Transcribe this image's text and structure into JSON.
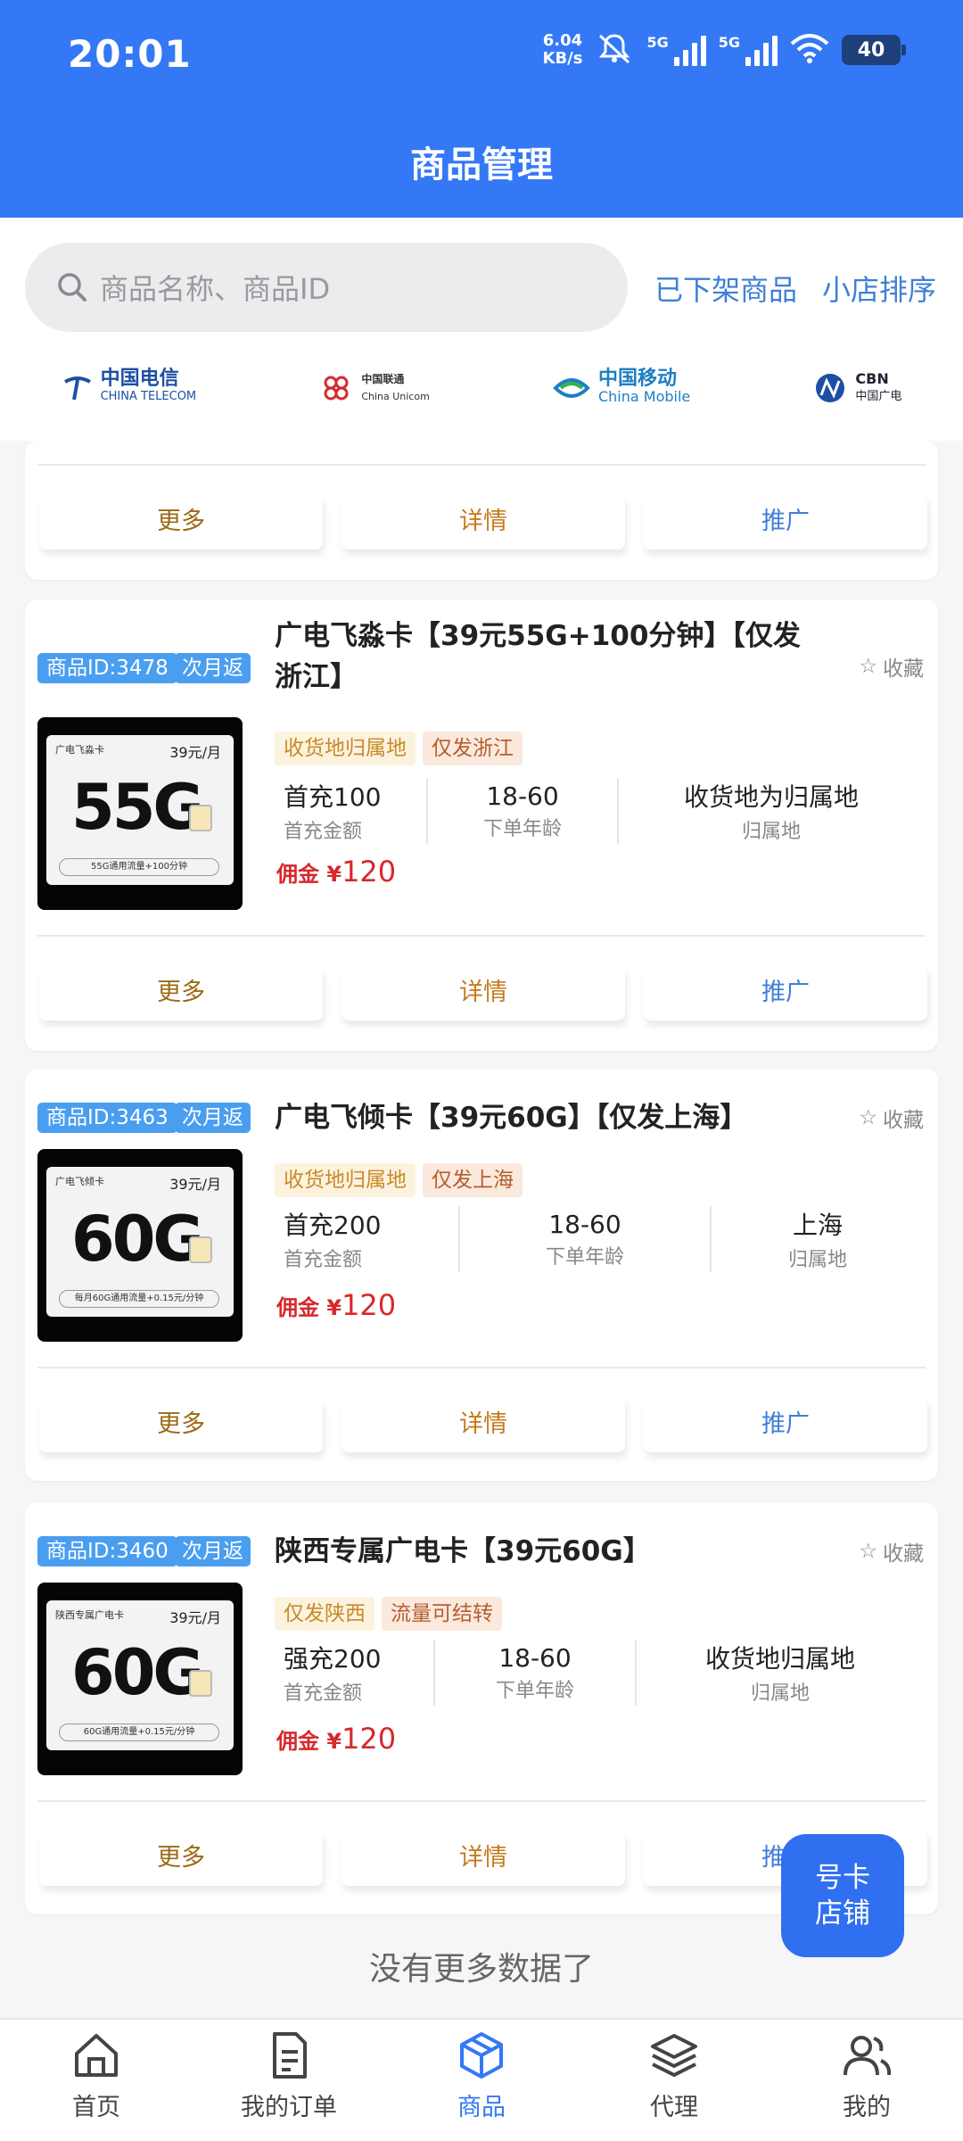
{
  "status": {
    "time": "20:01",
    "netspeed_value": "6.04",
    "netspeed_unit": "KB/s",
    "sig1": "5G",
    "sig2": "5G",
    "battery": "40"
  },
  "header": {
    "title": "商品管理"
  },
  "search": {
    "placeholder": "商品名称、商品ID",
    "removed_link": "已下架商品",
    "sort_link": "小店排序"
  },
  "operators": [
    {
      "name": "中国电信",
      "en": "CHINA TELECOM"
    },
    {
      "name": "中国联通",
      "en": "China Unicom"
    },
    {
      "name": "中国移动",
      "en": "China Mobile"
    },
    {
      "name": "中国广电",
      "en": "CBN"
    }
  ],
  "actions": {
    "more": "更多",
    "detail": "详情",
    "promote": "推广"
  },
  "products": [
    {
      "id_label": "商品ID:3478",
      "return_label": "次月返",
      "title": "广电飞淼卡【39元55G+100分钟】【仅发浙江】",
      "favorite": "收藏",
      "image": {
        "brand": "广电飞淼卡",
        "price": "39元/月",
        "data": "55G",
        "desc": "55G通用流量+100分钟"
      },
      "chips": [
        "收货地归属地",
        "仅发浙江"
      ],
      "stats": [
        {
          "value": "首充100",
          "label": "首充金额"
        },
        {
          "value": "18-60",
          "label": "下单年龄"
        },
        {
          "value": "收货地为归属地",
          "label": "归属地"
        }
      ],
      "commission_label": "佣金 ¥",
      "commission_value": "120"
    },
    {
      "id_label": "商品ID:3463",
      "return_label": "次月返",
      "title": "广电飞倾卡【39元60G】【仅发上海】",
      "favorite": "收藏",
      "image": {
        "brand": "广电飞倾卡",
        "price": "39元/月",
        "data": "60G",
        "desc": "每月60G通用流量+0.15元/分钟"
      },
      "chips": [
        "收货地归属地",
        "仅发上海"
      ],
      "stats": [
        {
          "value": "首充200",
          "label": "首充金额"
        },
        {
          "value": "18-60",
          "label": "下单年龄"
        },
        {
          "value": "上海",
          "label": "归属地"
        }
      ],
      "commission_label": "佣金 ¥",
      "commission_value": "120"
    },
    {
      "id_label": "商品ID:3460",
      "return_label": "次月返",
      "title": "陕西专属广电卡【39元60G】",
      "favorite": "收藏",
      "image": {
        "brand": "陕西专属广电卡",
        "price": "39元/月",
        "data": "60G",
        "desc": "60G通用流量+0.15元/分钟"
      },
      "chips": [
        "仅发陕西",
        "流量可结转"
      ],
      "stats": [
        {
          "value": "强充200",
          "label": "首充金额"
        },
        {
          "value": "18-60",
          "label": "下单年龄"
        },
        {
          "value": "收货地归属地",
          "label": "归属地"
        }
      ],
      "commission_label": "佣金 ¥",
      "commission_value": "120"
    }
  ],
  "footer": {
    "no_more": "没有更多数据了"
  },
  "float_button": {
    "line1": "号卡",
    "line2": "店铺"
  },
  "nav": [
    {
      "label": "首页",
      "icon": "home-icon"
    },
    {
      "label": "我的订单",
      "icon": "document-icon"
    },
    {
      "label": "商品",
      "icon": "box-icon",
      "active": true
    },
    {
      "label": "代理",
      "icon": "layers-icon"
    },
    {
      "label": "我的",
      "icon": "users-icon"
    }
  ]
}
